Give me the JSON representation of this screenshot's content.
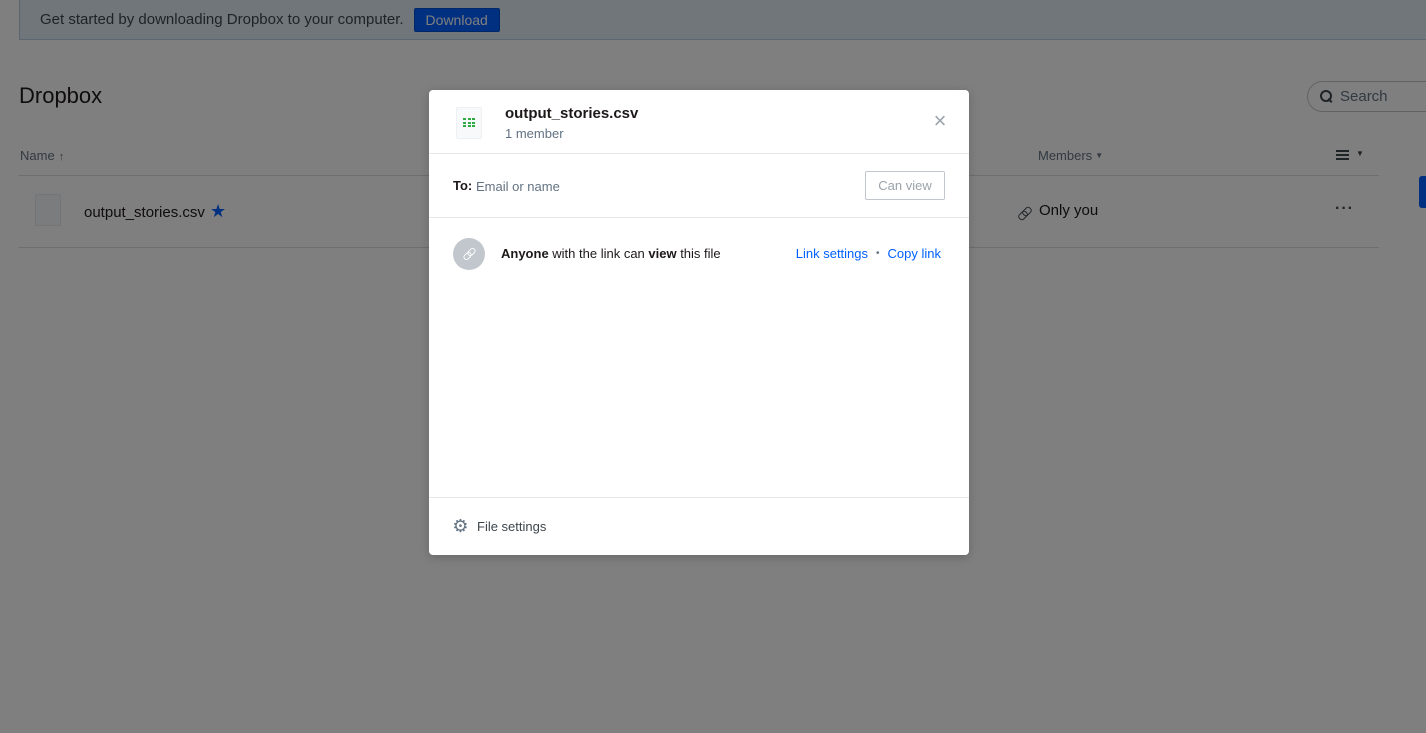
{
  "banner": {
    "text": "Get started by downloading Dropbox to your computer.",
    "button": "Download"
  },
  "page": {
    "title": "Dropbox"
  },
  "search": {
    "placeholder": "Search"
  },
  "table": {
    "headers": {
      "name": "Name",
      "name_sort": "↑",
      "members": "Members"
    },
    "rows": [
      {
        "name": "output_stories.csv",
        "starred": true,
        "members": "Only you",
        "more": "···"
      }
    ]
  },
  "modal": {
    "file_name": "output_stories.csv",
    "member_count": "1 member",
    "close": "×",
    "to_label": "To:",
    "to_placeholder": "Email or name",
    "permission": "Can view",
    "link": {
      "anyone": "Anyone",
      "mid": " with the link can ",
      "view": "view",
      "end": " this file",
      "settings": "Link settings",
      "separator": "•",
      "copy": "Copy link"
    },
    "footer": {
      "label": "File settings"
    }
  },
  "colors": {
    "accent": "#0061fe",
    "csv_icon": "#2fac41",
    "overlay": "rgba(0,0,0,0.5)"
  },
  "icons": [
    "search-icon",
    "list-view-icon",
    "star-icon",
    "link-icon",
    "more-icon",
    "csv-file-icon",
    "close-icon",
    "gear-icon"
  ]
}
